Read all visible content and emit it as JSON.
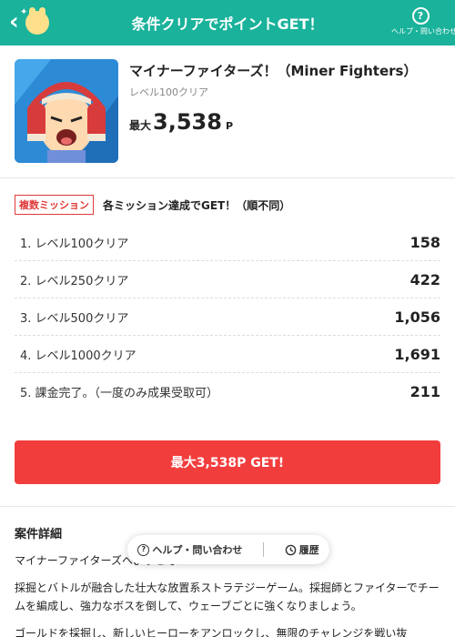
{
  "header": {
    "title": "条件クリアでポイントGET！",
    "help_label": "ヘルプ・問い合わせ",
    "help_icon": "question-circle-icon",
    "back_icon": "chevron-left-icon",
    "accent_color": "#1ab29b"
  },
  "app": {
    "name": "マイナーファイターズ！（Miner Fighters）",
    "subtitle": "レベル100クリア",
    "max_prefix": "最大",
    "max_points": "3,538",
    "unit": "P"
  },
  "mission": {
    "badge": "複数ミッション",
    "description": "各ミッション達成でGET！（順不同）",
    "items": [
      {
        "label": "1. レベル100クリア",
        "points": "158"
      },
      {
        "label": "2. レベル250クリア",
        "points": "422"
      },
      {
        "label": "3. レベル500クリア",
        "points": "1,056"
      },
      {
        "label": "4. レベル1000クリア",
        "points": "1,691"
      },
      {
        "label": "5. 課金完了。（一度のみ成果受取可）",
        "points": "211"
      }
    ]
  },
  "cta": {
    "label": "最大3,538P GET!",
    "color": "#f23d3d"
  },
  "details": {
    "title": "案件詳細",
    "paragraphs": [
      "マイナーファイターズへようこそ！",
      "採掘とバトルが融合した壮大な放置系ストラテジーゲーム。採掘師とファイターでチームを編成し、強力なボスを倒して、ウェーブごとに強くなりましょう。",
      "ゴールドを採掘し、新しいヒーローをアンロックし、無限のチャレンジを戦い抜"
    ]
  },
  "floating": {
    "help_label": "ヘルプ・問い合わせ",
    "history_label": "履歴",
    "help_icon": "question-circle-icon",
    "history_icon": "clock-history-icon"
  }
}
